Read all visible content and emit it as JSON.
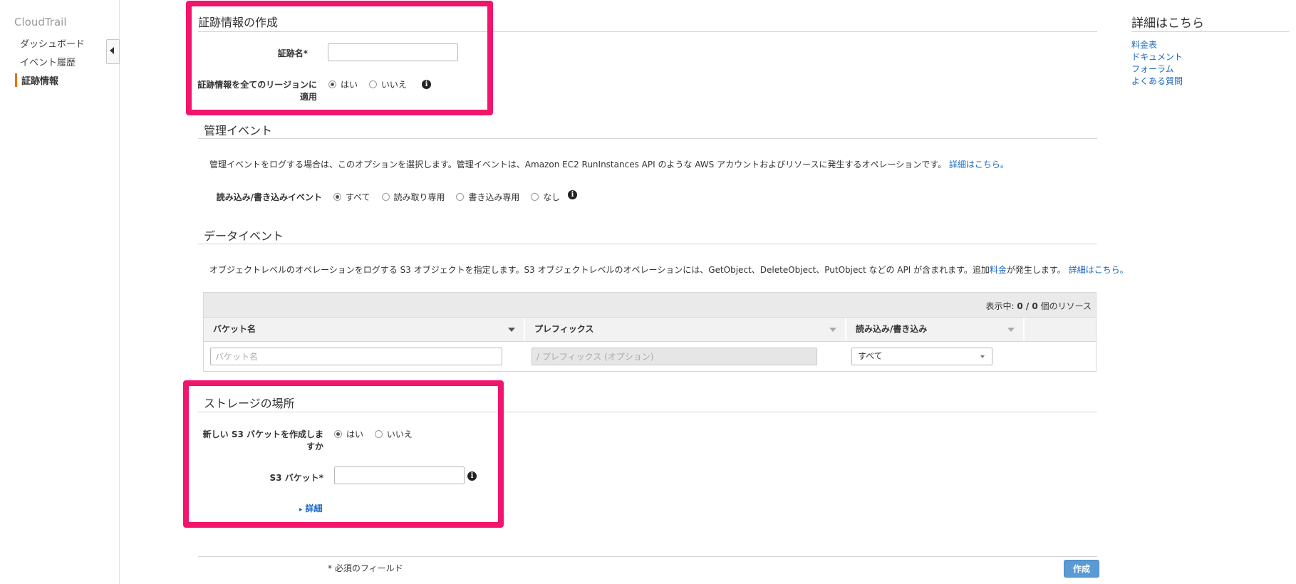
{
  "nav": {
    "title": "CloudTrail",
    "items": [
      {
        "label": "ダッシュボード"
      },
      {
        "label": "イベント履歴"
      },
      {
        "label": "証跡情報"
      }
    ]
  },
  "trail": {
    "title": "証跡情報の作成",
    "name_label": "証跡名*",
    "name_value": "",
    "all_regions_label_line1": "証跡情報を全てのリージョンに",
    "all_regions_label_line2": "適用",
    "yes": "はい",
    "no": "いいえ",
    "selected": "はい"
  },
  "management": {
    "title": "管理イベント",
    "description": "管理イベントをログする場合は、このオプションを選択します。管理イベントは、Amazon EC2 RunInstances API のような AWS アカウントおよびリソースに発生するオペレーションです。",
    "more_link": "詳細はこちら。",
    "rw_label": "読み込み/書き込みイベント",
    "options": [
      "すべて",
      "読み取り専用",
      "書き込み専用",
      "なし"
    ],
    "selected": "すべて"
  },
  "data_events": {
    "title": "データイベント",
    "description_part1": "オブジェクトレベルのオペレーションをログする S3 オブジェクトを指定します。S3 オブジェクトレベルのオペレーションには、GetObject、DeleteObject、PutObject などの API が含まれます。追加",
    "pricing_link": "料金",
    "description_part2": "が発生します。",
    "more_link": "詳細はこちら。",
    "table": {
      "display_prefix": "表示中: ",
      "display_count": "0 / 0",
      "display_suffix": " 個のリソース",
      "columns": [
        "バケット名",
        "プレフィックス",
        "読み込み/書き込み"
      ],
      "bucket_placeholder": "バケット名",
      "prefix_placeholder": "/ プレフィックス (オプション)",
      "rw_value": "すべて"
    }
  },
  "storage": {
    "title": "ストレージの場所",
    "new_bucket_label_line1": "新しい S3 バケットを作成しま",
    "new_bucket_label_line2": "すか",
    "yes": "はい",
    "no": "いいえ",
    "selected": "はい",
    "bucket_label": "S3 バケット*",
    "bucket_value": "",
    "details_link": "詳細"
  },
  "footer": {
    "required_note": "* 必須のフィールド",
    "create_button": "作成"
  },
  "sidebar_right": {
    "title": "詳細はこちら",
    "links": [
      "料金表",
      "ドキュメント",
      "フォーラム",
      "よくある質問"
    ]
  },
  "colors": {
    "highlight": "#f2156b",
    "accent": "#ec7211",
    "link": "#1a66c2",
    "primary_button": "#5b9bd5"
  }
}
